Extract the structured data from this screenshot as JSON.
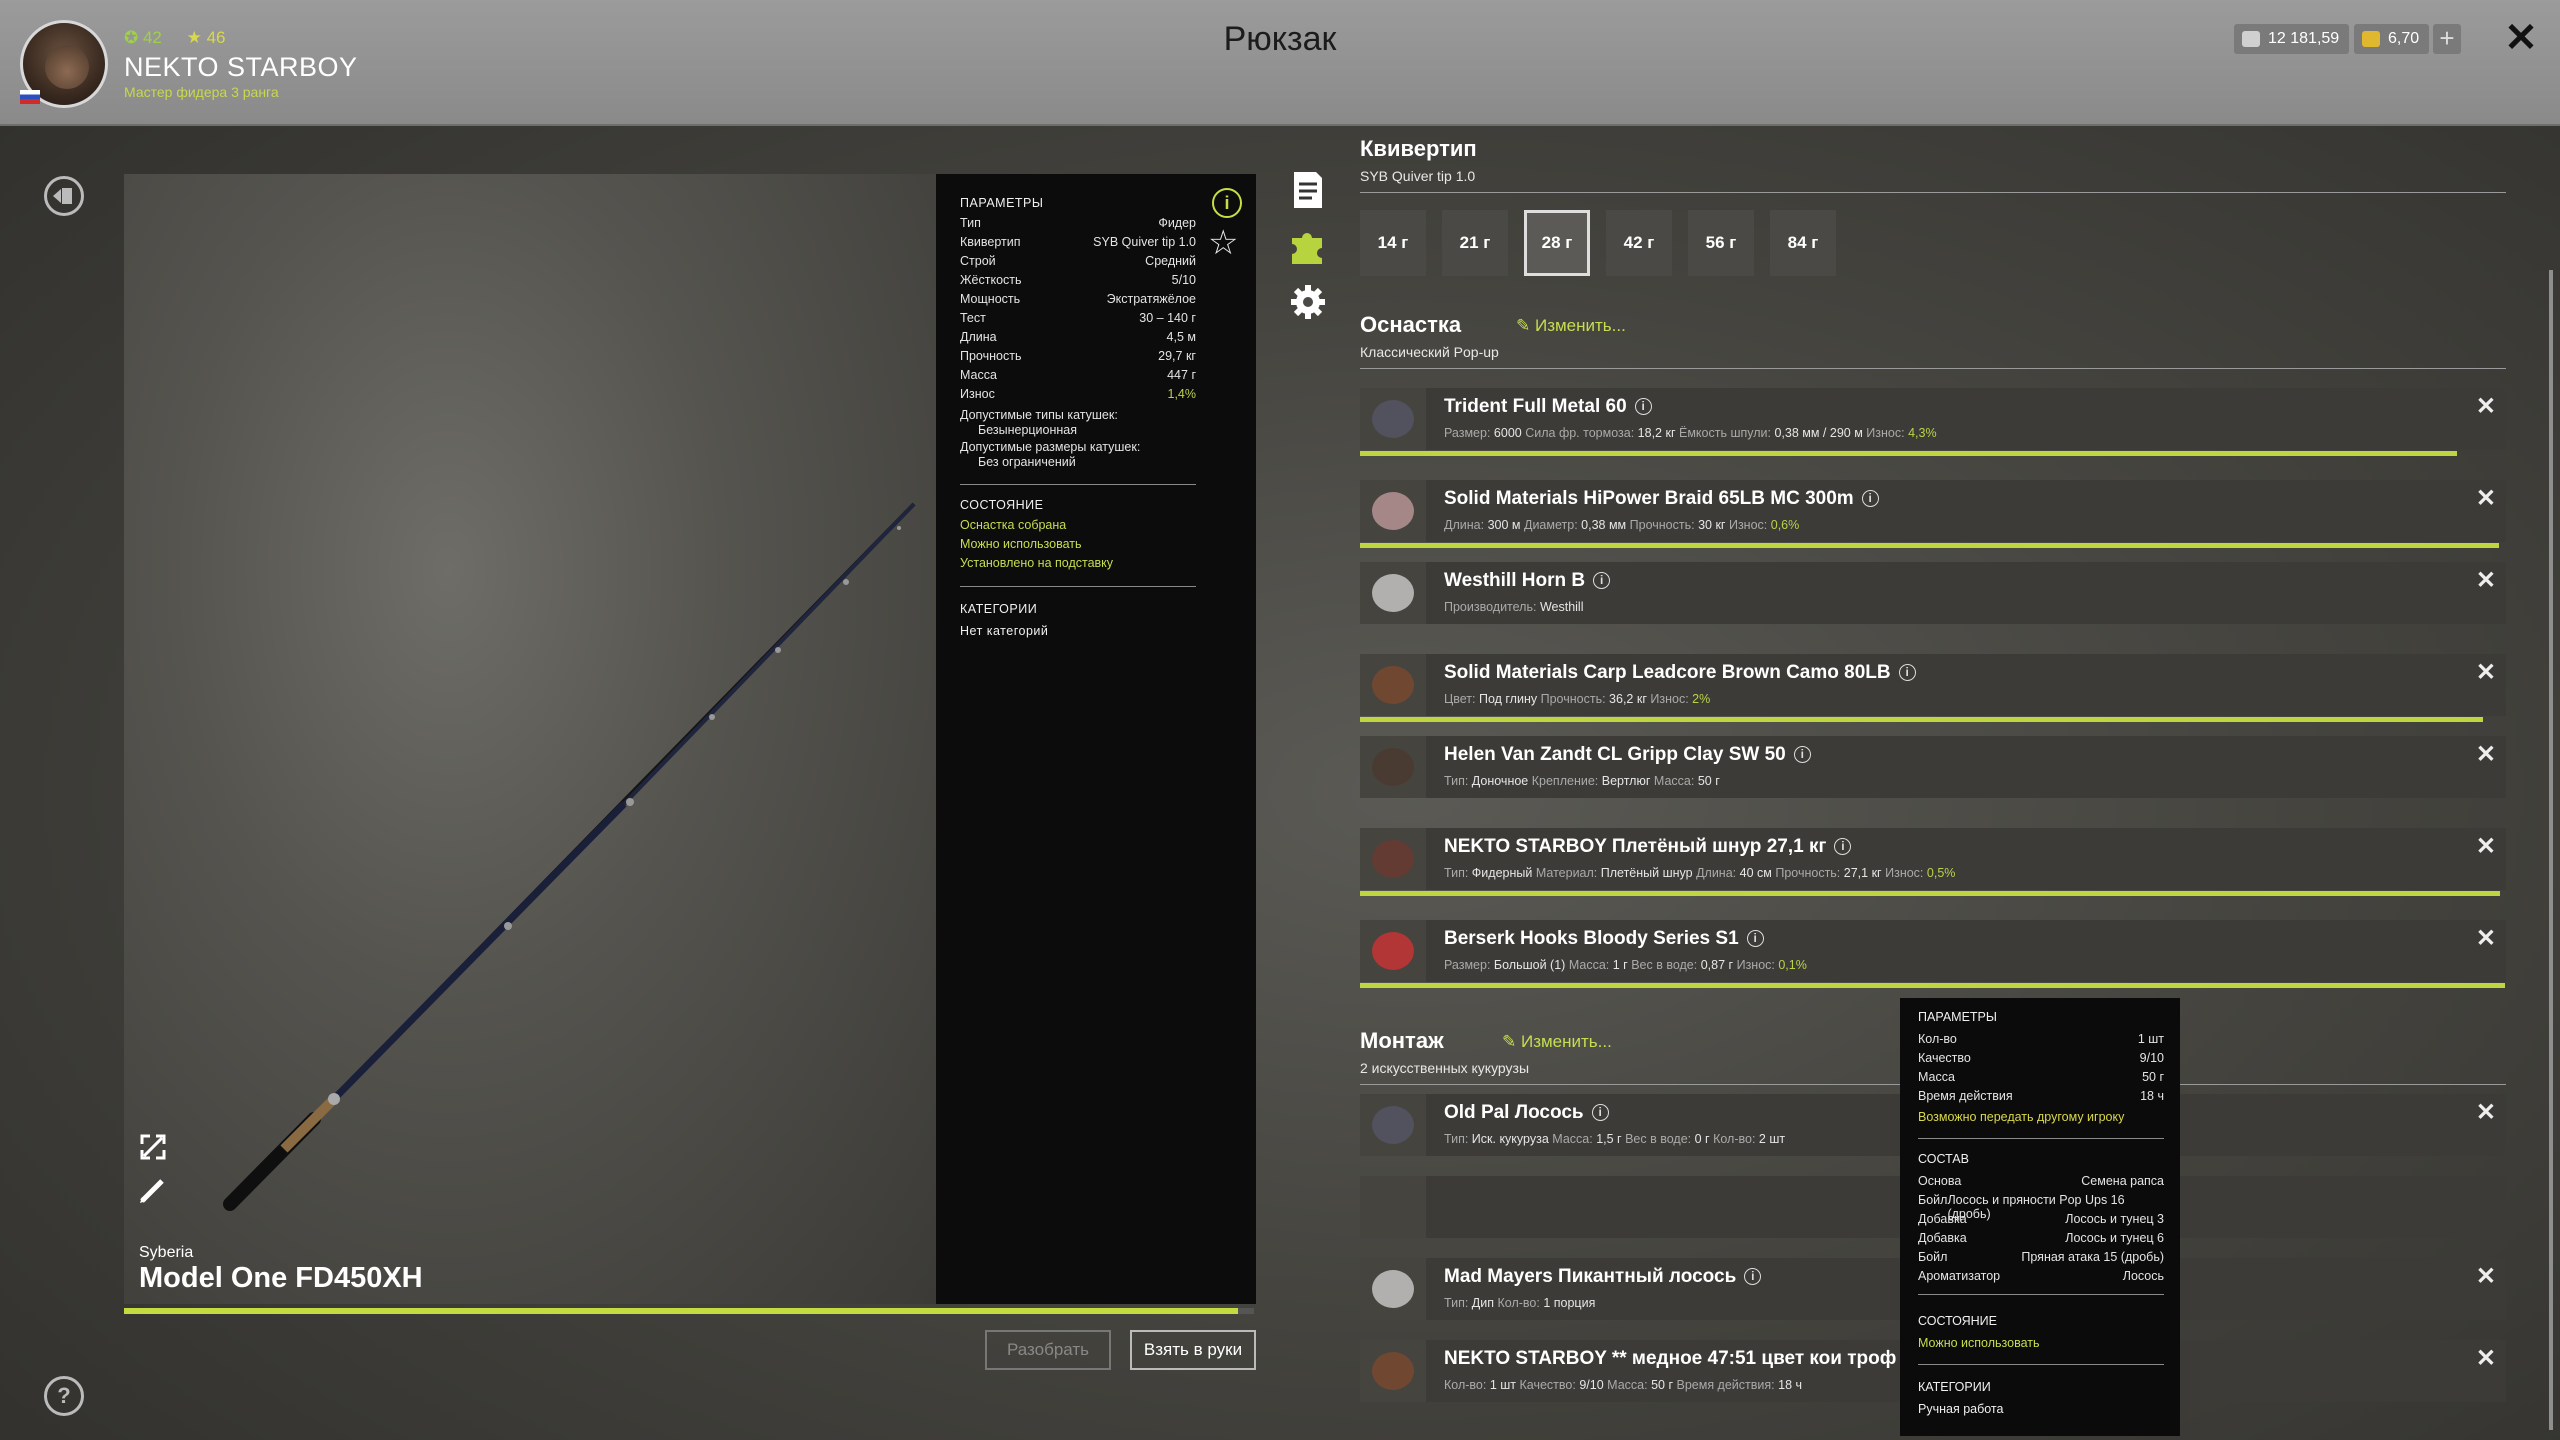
{
  "header": {
    "title": "Рюкзак",
    "player": {
      "level_green": "42",
      "level_gold": "46",
      "name": "NEKTO STARBOY",
      "rank": "Мастер фидера 3 ранга"
    },
    "silver": "12 181,59",
    "gold": "6,70",
    "plus": "+",
    "close": "✕"
  },
  "rod": {
    "brand": "Syberia",
    "name": "Model One FD450XH",
    "durability_fraction": 0.986,
    "buttons": {
      "disassemble": "Разобрать",
      "take": "Взять в руки"
    }
  },
  "params": {
    "heading": "ПАРАМЕТРЫ",
    "rows": [
      {
        "k": "Тип",
        "v": "Фидер"
      },
      {
        "k": "Квивертип",
        "v": "SYB Quiver tip 1.0"
      },
      {
        "k": "Строй",
        "v": "Средний"
      },
      {
        "k": "Жёсткость",
        "v": "5/10"
      },
      {
        "k": "Мощность",
        "v": "Экстратяжёлое"
      },
      {
        "k": "Тест",
        "v": "30 – 140 г"
      },
      {
        "k": "Длина",
        "v": "4,5 м"
      },
      {
        "k": "Прочность",
        "v": "29,7 кг"
      },
      {
        "k": "Масса",
        "v": "447 г"
      },
      {
        "k": "Износ",
        "v": "1,4%"
      }
    ],
    "reel_types_label": "Допустимые типы катушек:",
    "reel_types_value": "Безынерционная",
    "reel_sizes_label": "Допустимые размеры катушек:",
    "reel_sizes_value": "Без ограничений",
    "state_heading": "СОСТОЯНИЕ",
    "states": [
      "Оснастка собрана",
      "Можно использовать",
      "Установлено на подставку"
    ],
    "categories_heading": "КАТЕГОРИИ",
    "categories_value": "Нет категорий"
  },
  "quivertip": {
    "title": "Квивертип",
    "subtitle": "SYB Quiver tip 1.0",
    "options": [
      "14 г",
      "21 г",
      "28 г",
      "42 г",
      "56 г",
      "84 г"
    ],
    "selected": "28 г"
  },
  "tackle": {
    "title": "Оснастка",
    "edit": "Изменить...",
    "subtitle": "Классический Pop-up",
    "items": [
      {
        "name": "Trident Full Metal 60",
        "details": [
          [
            "Размер:",
            "6000"
          ],
          [
            "Сила фр. тормоза:",
            "18,2 кг"
          ],
          [
            "Ёмкость шпули:",
            "0,38 мм / 290 м"
          ],
          [
            "Износ:",
            "4,3%"
          ]
        ],
        "bar": 0.957
      },
      {
        "name": "Solid Materials HiPower Braid 65LB MC 300m",
        "details": [
          [
            "Длина:",
            "300 м"
          ],
          [
            "Диаметр:",
            "0,38 мм"
          ],
          [
            "Прочность:",
            "30 кг"
          ],
          [
            "Износ:",
            "0,6%"
          ]
        ],
        "bar": 0.994
      },
      {
        "name": "Westhill Horn B",
        "details": [
          [
            "Производитель:",
            "Westhill"
          ]
        ],
        "bar": null
      },
      {
        "name": "Solid Materials Carp Leadcore Brown Camo 80LB",
        "details": [
          [
            "Цвет:",
            "Под глину"
          ],
          [
            "Прочность:",
            "36,2 кг"
          ],
          [
            "Износ:",
            "2%"
          ]
        ],
        "bar": 0.98
      },
      {
        "name": "Helen Van Zandt CL Gripp Clay SW 50",
        "details": [
          [
            "Тип:",
            "Доночное"
          ],
          [
            "Крепление:",
            "Вертлюг"
          ],
          [
            "Масса:",
            "50 г"
          ]
        ],
        "bar": null
      },
      {
        "name": "NEKTO STARBOY Плетёный шнур 27,1 кг",
        "details": [
          [
            "Тип:",
            "Фидерный"
          ],
          [
            "Материал:",
            "Плетёный шнур"
          ],
          [
            "Длина:",
            "40 см"
          ],
          [
            "Прочность:",
            "27,1 кг"
          ],
          [
            "Износ:",
            "0,5%"
          ]
        ],
        "bar": 0.995
      },
      {
        "name": "Berserk Hooks Bloody Series S1",
        "details": [
          [
            "Размер:",
            "Большой (1)"
          ],
          [
            "Масса:",
            "1 г"
          ],
          [
            "Вес в воде:",
            "0,87 г"
          ],
          [
            "Износ:",
            "0,1%"
          ]
        ],
        "bar": 0.999
      }
    ]
  },
  "montage": {
    "title": "Монтаж",
    "edit": "Изменить...",
    "subtitle": "2 искусственных кукурузы",
    "items": [
      {
        "name": "Old Pal Лосось",
        "details": [
          [
            "Тип:",
            "Иск. кукуруза"
          ],
          [
            "Масса:",
            "1,5 г"
          ],
          [
            "Вес в воде:",
            "0 г"
          ],
          [
            "Кол-во:",
            "2 шт"
          ]
        ]
      },
      {
        "name": "",
        "details": []
      },
      {
        "name": "Mad Mayers Пикантный лосось",
        "details": [
          [
            "Тип:",
            "Дип"
          ],
          [
            "Кол-во:",
            "1 порция"
          ]
        ]
      },
      {
        "name": "NEKTO STARBOY ** медное 47:51 цвет кои троф **",
        "details": [
          [
            "Кол-во:",
            "1 шт"
          ],
          [
            "Качество:",
            "9/10"
          ],
          [
            "Масса:",
            "50 г"
          ],
          [
            "Время действия:",
            "18 ч"
          ]
        ]
      }
    ]
  },
  "tooltip": {
    "heading": "ПАРАМЕТРЫ",
    "rows": [
      {
        "k": "Кол-во",
        "v": "1 шт"
      },
      {
        "k": "Качество",
        "v": "9/10"
      },
      {
        "k": "Масса",
        "v": "50 г"
      },
      {
        "k": "Время действия",
        "v": "18 ч"
      }
    ],
    "transfer": "Возможно передать другому игроку",
    "composition_heading": "СОСТАВ",
    "composition": [
      {
        "k": "Основа",
        "v": "Семена рапса"
      },
      {
        "k": "Бойл",
        "v": "Лосось и пряности Pop Ups 16 (дробь)"
      },
      {
        "k": "Добавка",
        "v": "Лосось и тунец 3"
      },
      {
        "k": "Добавка",
        "v": "Лосось и тунец 6"
      },
      {
        "k": "Бойл",
        "v": "Пряная атака 15 (дробь)"
      },
      {
        "k": "Ароматизатор",
        "v": "Лосось"
      }
    ],
    "state_heading": "СОСТОЯНИЕ",
    "state_value": "Можно использовать",
    "categories_heading": "КАТЕГОРИИ",
    "categories_value": "Ручная работа"
  },
  "icons": [
    "exit-icon",
    "help-icon",
    "expand-icon",
    "pencil-icon",
    "document-icon",
    "puzzle-icon",
    "gear-icon",
    "info-icon",
    "star-icon",
    "edit-icon",
    "close-icon"
  ],
  "colors": {
    "accent": "#c4dc40",
    "gold": "#d8d84a"
  }
}
